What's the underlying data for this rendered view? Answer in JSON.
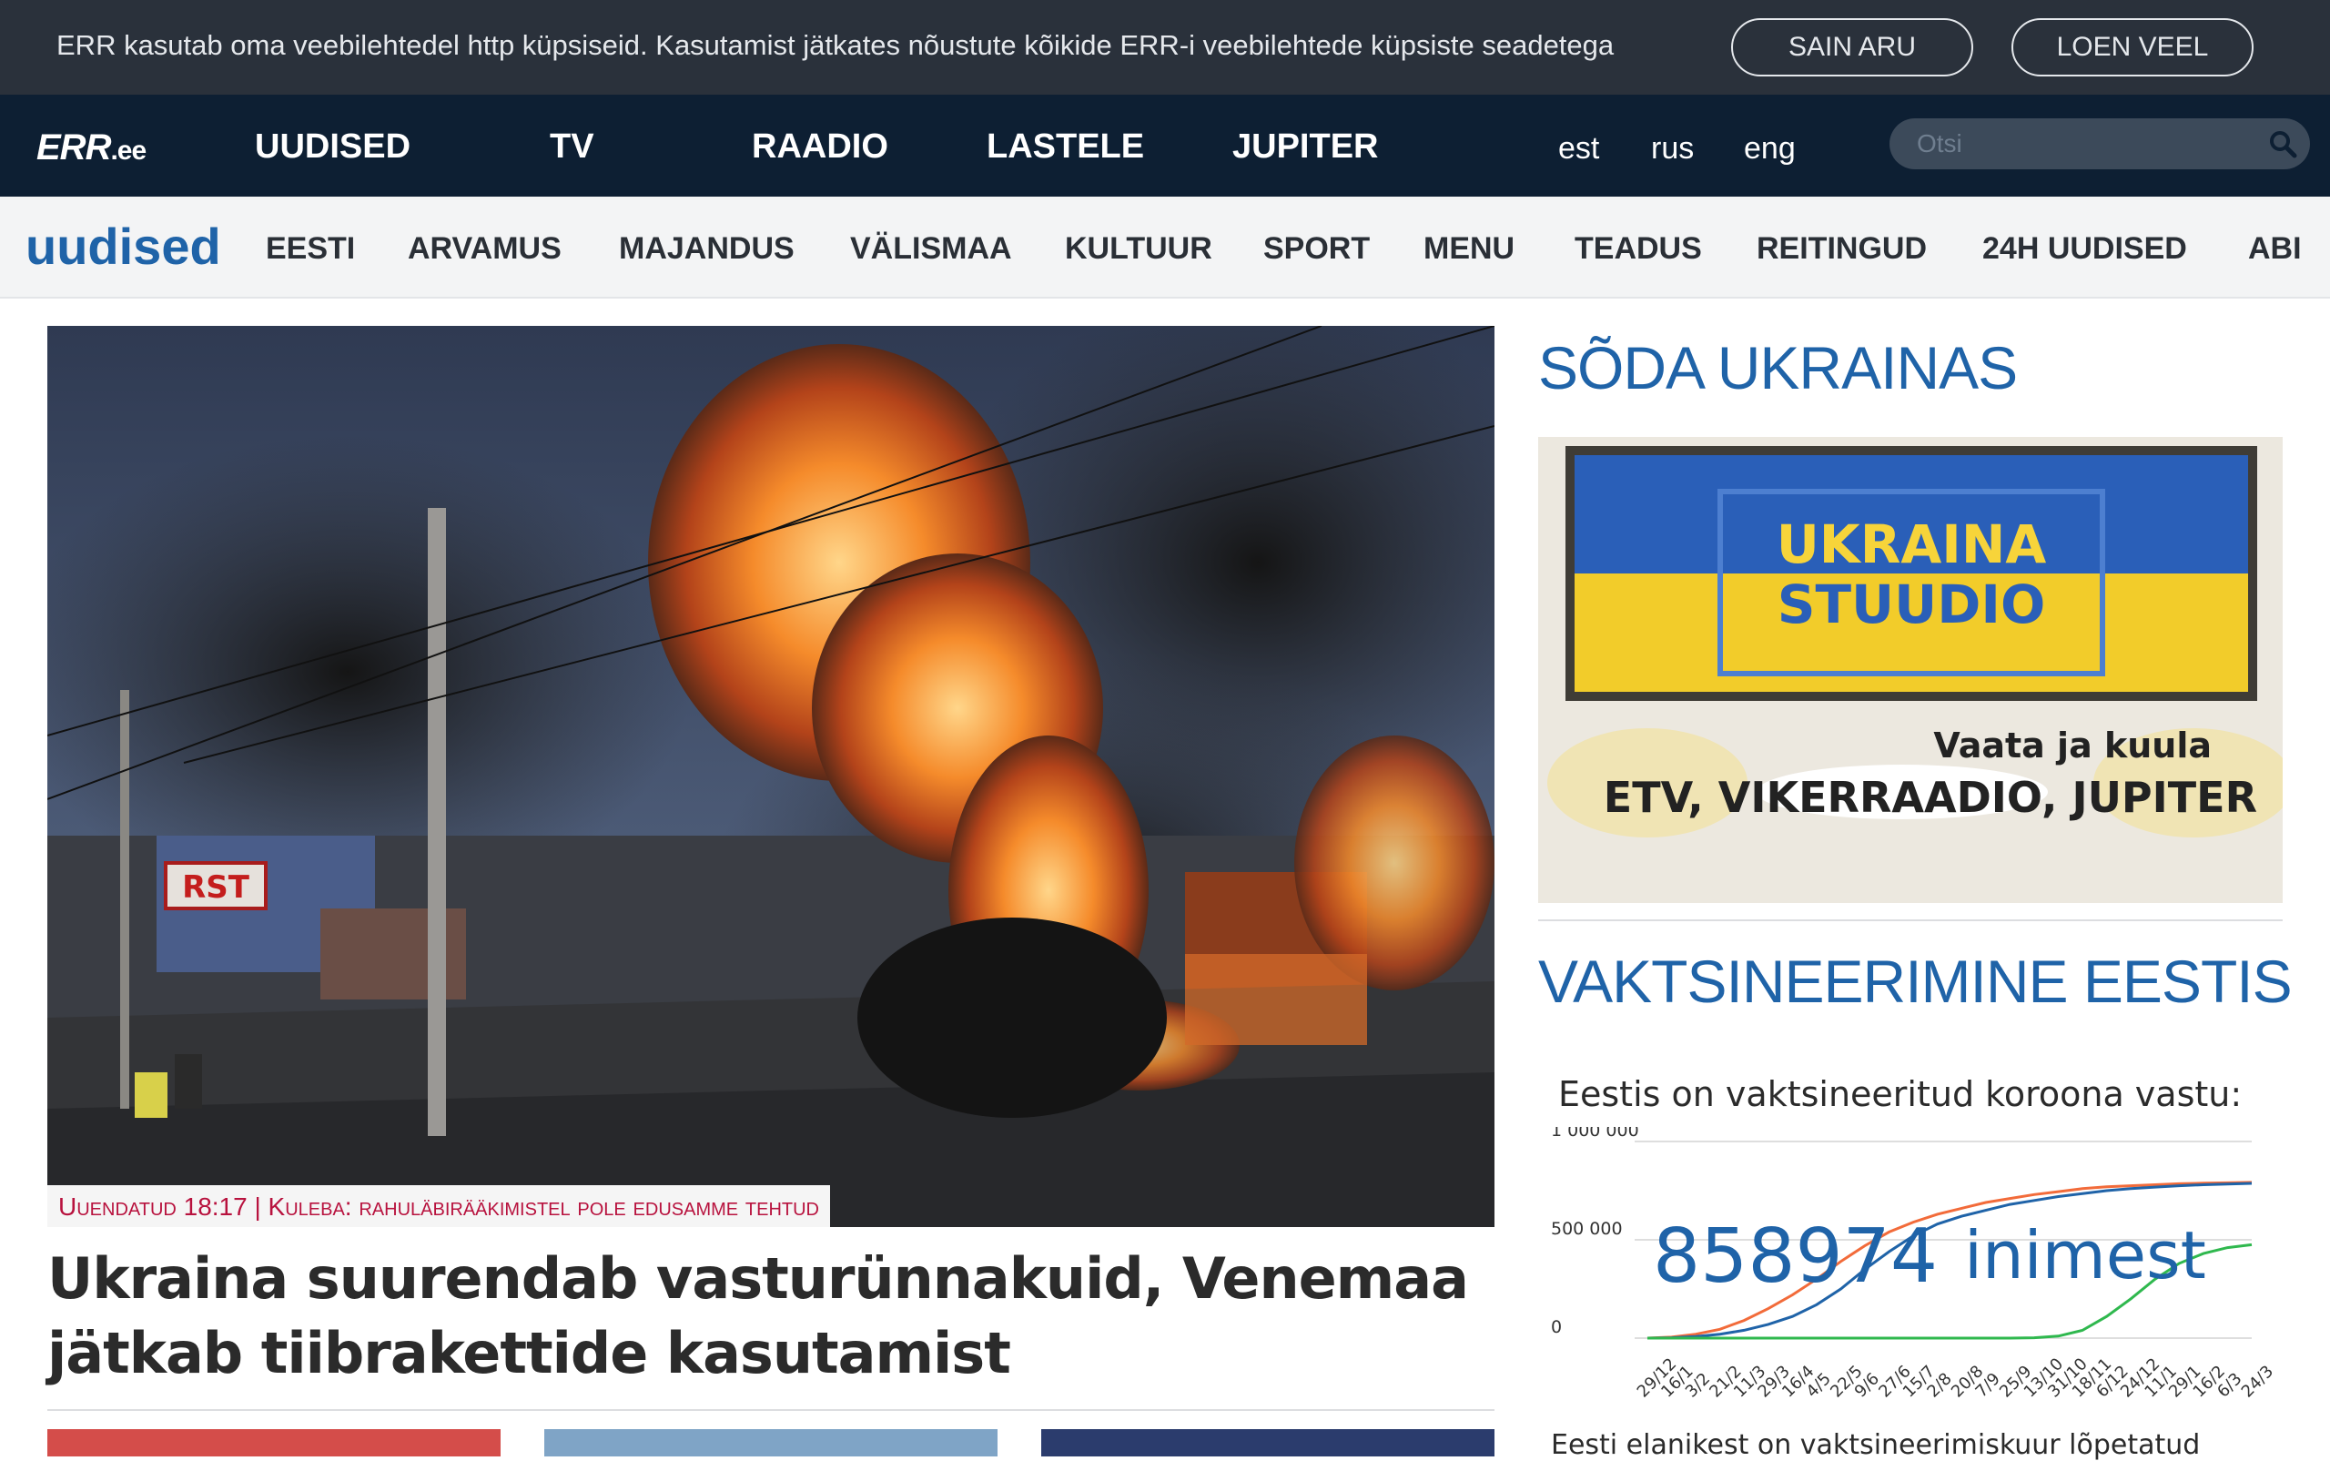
{
  "cookie_bar": {
    "text": "ERR kasutab oma veebilehtedel http küpsiseid. Kasutamist jätkates nõustute kõikide ERR-i veebilehtede küpsiste seadetega",
    "agree_label": "SAIN ARU",
    "more_label": "LOEN VEEL"
  },
  "top_nav": {
    "logo_main": "ERR",
    "logo_suffix": ".ee",
    "items": [
      "UUDISED",
      "TV",
      "RAADIO",
      "LASTELE",
      "JUPITER"
    ],
    "languages": [
      "est",
      "rus",
      "eng"
    ],
    "search_placeholder": "Otsi"
  },
  "section_nav": {
    "logo": "uudised",
    "items": [
      "EESTI",
      "ARVAMUS",
      "MAJANDUS",
      "VÄLISMAA",
      "KULTUUR",
      "SPORT",
      "MENU",
      "TEADUS",
      "REITINGUD",
      "24H UUDISED",
      "ABI"
    ]
  },
  "hero": {
    "caption": "Uuendatud 18:17 | Kuleba: rahuläbirääkimistel pole edusamme tehtud",
    "sign_text": "RST",
    "headline": "Ukraina suurendab vasturünnakuid, Venemaa jätkab tiibrakettide kasutamist"
  },
  "war_section": {
    "title": "SÕDA UKRAINAS",
    "banner_line1": "UKRAINA",
    "banner_line2": "STUUDIO",
    "banner_tagline": "Vaata ja kuula",
    "banner_channels": "ETV, VIKERRAADIO, JUPITER"
  },
  "vaccination": {
    "title": "VAKTSINEERIMINE EESTIS",
    "subtitle": "Eestis on vaktsineeritud koroona vastu:",
    "big_number": "858974",
    "big_unit": "inimest",
    "bottom_text": "Eesti elanikest on vaktsineerimiskuur lõpetatud",
    "colors": {
      "orange": "#f26b3a",
      "blue": "#1f63a8",
      "green": "#2fb84e"
    }
  },
  "chart_data": {
    "type": "line",
    "ylim": [
      0,
      1000000
    ],
    "yticks": [
      "1 000 000",
      "500 000",
      "0"
    ],
    "categories": [
      "29/12",
      "16/1",
      "3/2",
      "21/2",
      "11/3",
      "29/3",
      "16/4",
      "4/5",
      "22/5",
      "9/6",
      "27/6",
      "15/7",
      "2/8",
      "20/8",
      "7/9",
      "25/9",
      "13/10",
      "31/10",
      "18/11",
      "6/12",
      "24/12",
      "11/1",
      "29/1",
      "16/2",
      "6/3",
      "24/3"
    ],
    "series": [
      {
        "color": "#f26b3a",
        "values": [
          0,
          5000,
          20000,
          45000,
          90000,
          150000,
          220000,
          300000,
          390000,
          470000,
          540000,
          590000,
          630000,
          660000,
          690000,
          710000,
          730000,
          745000,
          760000,
          770000,
          775000,
          780000,
          785000,
          788000,
          790000,
          792000
        ]
      },
      {
        "color": "#1f63a8",
        "values": [
          0,
          2000,
          8000,
          20000,
          40000,
          70000,
          110000,
          170000,
          250000,
          350000,
          440000,
          520000,
          580000,
          620000,
          650000,
          680000,
          700000,
          720000,
          735000,
          750000,
          760000,
          768000,
          775000,
          780000,
          784000,
          787000
        ]
      },
      {
        "color": "#2fb84e",
        "values": [
          0,
          0,
          0,
          0,
          0,
          0,
          0,
          0,
          0,
          0,
          0,
          0,
          0,
          0,
          0,
          0,
          2000,
          10000,
          40000,
          110000,
          200000,
          300000,
          380000,
          430000,
          460000,
          475000
        ]
      }
    ]
  }
}
